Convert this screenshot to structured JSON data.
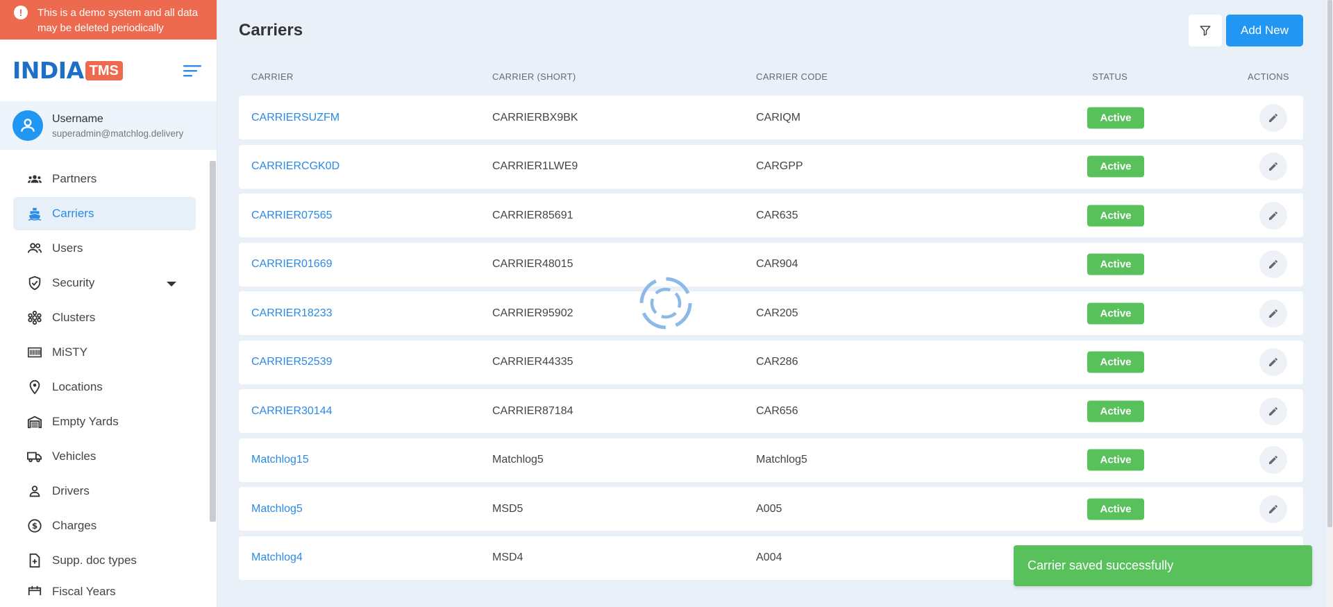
{
  "banner": {
    "text": "This is a demo system and all data may be deleted periodically",
    "icon": "exclamation-icon"
  },
  "brand": {
    "logo_main": "INDIA",
    "logo_badge": "TMS"
  },
  "user": {
    "name": "Username",
    "email": "superadmin@matchlog.delivery"
  },
  "sidebar": {
    "items": [
      {
        "label": "Partners",
        "icon": "partners-icon"
      },
      {
        "label": "Carriers",
        "icon": "ship-icon",
        "active": true
      },
      {
        "label": "Users",
        "icon": "users-icon"
      },
      {
        "label": "Security",
        "icon": "shield-icon",
        "has_submenu": true
      },
      {
        "label": "Clusters",
        "icon": "cluster-icon"
      },
      {
        "label": "MiSTY",
        "icon": "barcode-icon"
      },
      {
        "label": "Locations",
        "icon": "pin-icon"
      },
      {
        "label": "Empty Yards",
        "icon": "warehouse-icon"
      },
      {
        "label": "Vehicles",
        "icon": "truck-icon"
      },
      {
        "label": "Drivers",
        "icon": "person-icon"
      },
      {
        "label": "Charges",
        "icon": "dollar-icon"
      },
      {
        "label": "Supp. doc types",
        "icon": "doc-add-icon"
      },
      {
        "label": "Fiscal Years",
        "icon": "calendar-icon"
      }
    ]
  },
  "page": {
    "title": "Carriers",
    "add_label": "Add New"
  },
  "table": {
    "headers": {
      "carrier": "CARRIER",
      "carrier_short": "CARRIER (SHORT)",
      "carrier_code": "CARRIER CODE",
      "status": "STATUS",
      "actions": "ACTIONS"
    },
    "rows": [
      {
        "carrier": "CARRIERSUZFM",
        "short": "CARRIERBX9BK",
        "code": "CARIQM",
        "status": "Active"
      },
      {
        "carrier": "CARRIERCGK0D",
        "short": "CARRIER1LWE9",
        "code": "CARGPP",
        "status": "Active"
      },
      {
        "carrier": "CARRIER07565",
        "short": "CARRIER85691",
        "code": "CAR635",
        "status": "Active"
      },
      {
        "carrier": "CARRIER01669",
        "short": "CARRIER48015",
        "code": "CAR904",
        "status": "Active"
      },
      {
        "carrier": "CARRIER18233",
        "short": "CARRIER95902",
        "code": "CAR205",
        "status": "Active"
      },
      {
        "carrier": "CARRIER52539",
        "short": "CARRIER44335",
        "code": "CAR286",
        "status": "Active"
      },
      {
        "carrier": "CARRIER30144",
        "short": "CARRIER87184",
        "code": "CAR656",
        "status": "Active"
      },
      {
        "carrier": "Matchlog15",
        "short": "Matchlog5",
        "code": "Matchlog5",
        "status": "Active"
      },
      {
        "carrier": "Matchlog5",
        "short": "MSD5",
        "code": "A005",
        "status": "Active"
      },
      {
        "carrier": "Matchlog4",
        "short": "MSD4",
        "code": "A004",
        "status": ""
      }
    ]
  },
  "toast": {
    "message": "Carrier saved successfully"
  },
  "colors": {
    "banner": "#ee6a4e",
    "primary": "#2196f3",
    "link": "#2b8ae6",
    "success": "#58c15b",
    "background": "#eaf0f8"
  }
}
